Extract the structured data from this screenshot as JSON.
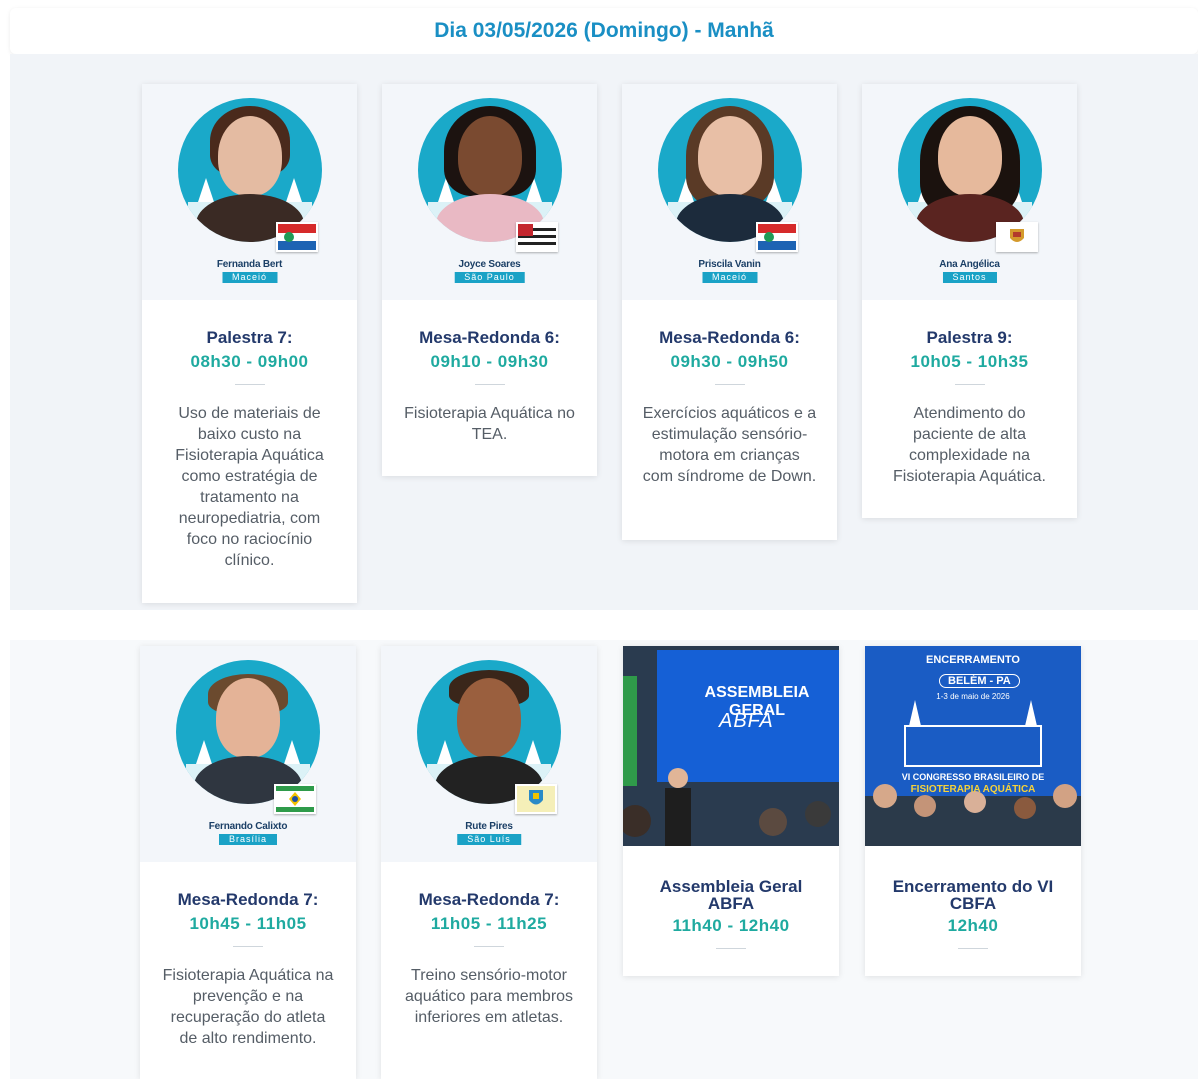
{
  "header": {
    "title": "Dia 03/05/2026 (Domingo) - Manhã"
  },
  "colors": {
    "accent": "#1a8fc4",
    "title": "#23396b",
    "time": "#1faaa0",
    "badge": "#1aa2c6"
  },
  "sessions": [
    {
      "speaker": "Fernanda Bert",
      "city": "Maceió",
      "title": "Palestra 7:",
      "time": "08h30 - 09h00",
      "desc": "Uso de materiais de baixo custo na Fisioterapia Aquática como estratégia de tratamento na neuropediatria, com foco no raciocínio clínico."
    },
    {
      "speaker": "Joyce Soares",
      "city": "São Paulo",
      "title": "Mesa-Redonda 6:",
      "time": "09h10 - 09h30",
      "desc": "Fisioterapia Aquática no TEA."
    },
    {
      "speaker": "Priscila Vanin",
      "city": "Maceió",
      "title": "Mesa-Redonda 6:",
      "time": "09h30 - 09h50",
      "desc": "Exercícios aquáticos e a estimulação sensório-motora em crianças com síndrome de Down."
    },
    {
      "speaker": "Ana Angélica",
      "city": "Santos",
      "title": "Palestra 9:",
      "time": "10h05 - 10h35",
      "desc": "Atendimento do paciente de alta complexidade na Fisioterapia Aquática."
    },
    {
      "speaker": "Fernando Calixto",
      "city": "Brasília",
      "title": "Mesa-Redonda 7:",
      "time": "10h45 - 11h05",
      "desc": "Fisioterapia Aquática na prevenção e na recuperação do atleta de alto rendimento."
    },
    {
      "speaker": "Rute Pires",
      "city": "São Luís",
      "title": "Mesa-Redonda 7:",
      "time": "11h05 - 11h25",
      "desc": "Treino sensório-motor aquático para membros inferiores em atletas."
    }
  ],
  "events": [
    {
      "title": "Assembleia Geral ABFA",
      "time": "11h40 - 12h40",
      "image": {
        "heading": "ASSEMBLEIA GERAL",
        "logo": "ABFA"
      }
    },
    {
      "title": "Encerramento do VI CBFA",
      "time": "12h40",
      "image": {
        "top": "ENCERRAMENTO",
        "city": "BELÉM - PA",
        "dates": "1-3 de maio de 2026",
        "line1": "VI CONGRESSO BRASILEIRO DE",
        "line2": "FISIOTERAPIA AQUÁTICA"
      }
    }
  ]
}
